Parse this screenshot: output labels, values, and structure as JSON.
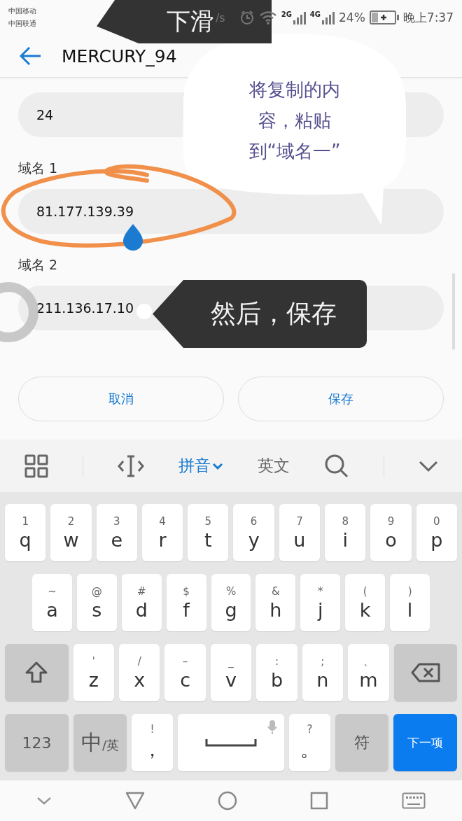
{
  "status_bar": {
    "carriers": [
      "中国移动",
      "中国联通"
    ],
    "speed": "/s",
    "networks": [
      "2G",
      "4G"
    ],
    "battery": "24%",
    "time": "晚上7:37"
  },
  "header": {
    "title": "MERCURY_94"
  },
  "form": {
    "fields": [
      {
        "value": "24"
      },
      {
        "label": "域名 1",
        "value": "81.177.139.39"
      },
      {
        "label": "域名 2",
        "value": "211.136.17.10"
      }
    ],
    "buttons": [
      "取消",
      "保存"
    ]
  },
  "keyboard": {
    "toolbar": [
      {
        "kind": "grid"
      },
      {
        "kind": "cursor"
      },
      {
        "kind": "mode",
        "label": "拼音",
        "selected": true
      },
      {
        "kind": "mode",
        "label": "英文",
        "selected": false
      },
      {
        "kind": "search"
      },
      {
        "kind": "collapse"
      }
    ],
    "rows": [
      {
        "keys": [
          {
            "kind": "letter",
            "alt": "1",
            "main": "q"
          },
          {
            "kind": "letter",
            "alt": "2",
            "main": "w"
          },
          {
            "kind": "letter",
            "alt": "3",
            "main": "e"
          },
          {
            "kind": "letter",
            "alt": "4",
            "main": "r"
          },
          {
            "kind": "letter",
            "alt": "5",
            "main": "t"
          },
          {
            "kind": "letter",
            "alt": "6",
            "main": "y"
          },
          {
            "kind": "letter",
            "alt": "7",
            "main": "u"
          },
          {
            "kind": "letter",
            "alt": "8",
            "main": "i"
          },
          {
            "kind": "letter",
            "alt": "9",
            "main": "o"
          },
          {
            "kind": "letter",
            "alt": "0",
            "main": "p"
          }
        ]
      },
      {
        "keys": [
          {
            "kind": "letter",
            "alt": "~",
            "main": "a"
          },
          {
            "kind": "letter",
            "alt": "@",
            "main": "s"
          },
          {
            "kind": "letter",
            "alt": "#",
            "main": "d"
          },
          {
            "kind": "letter",
            "alt": "$",
            "main": "f"
          },
          {
            "kind": "letter",
            "alt": "%",
            "main": "g"
          },
          {
            "kind": "letter",
            "alt": "&",
            "main": "h"
          },
          {
            "kind": "letter",
            "alt": "*",
            "main": "j"
          },
          {
            "kind": "letter",
            "alt": "(",
            "main": "k"
          },
          {
            "kind": "letter",
            "alt": ")",
            "main": "l"
          }
        ]
      },
      {
        "keys": [
          {
            "kind": "shift"
          },
          {
            "kind": "letter",
            "alt": "'",
            "main": "z"
          },
          {
            "kind": "letter",
            "alt": "/",
            "main": "x"
          },
          {
            "kind": "letter",
            "alt": "–",
            "main": "c"
          },
          {
            "kind": "letter",
            "alt": "_",
            "main": "v"
          },
          {
            "kind": "letter",
            "alt": ":",
            "main": "b"
          },
          {
            "kind": "letter",
            "alt": ";",
            "main": "n"
          },
          {
            "kind": "letter",
            "alt": "、",
            "main": "m"
          },
          {
            "kind": "backspace"
          }
        ]
      },
      {
        "keys": [
          {
            "kind": "function",
            "main": "123"
          },
          {
            "kind": "lang",
            "main": "中",
            "sub": "/英"
          },
          {
            "kind": "punct",
            "alt": "!",
            "main": "，"
          },
          {
            "kind": "space"
          },
          {
            "kind": "punct",
            "alt": "?",
            "main": "。"
          },
          {
            "kind": "function",
            "main": "符"
          },
          {
            "kind": "action",
            "main": "下一项"
          }
        ]
      }
    ]
  },
  "annotations": [
    {
      "kind": "dark",
      "text": "下滑"
    },
    {
      "kind": "bubble",
      "lines": [
        "将复制的内",
        "容，粘贴",
        "到“域名一”"
      ]
    },
    {
      "kind": "dark",
      "text": "然后，保存"
    }
  ]
}
